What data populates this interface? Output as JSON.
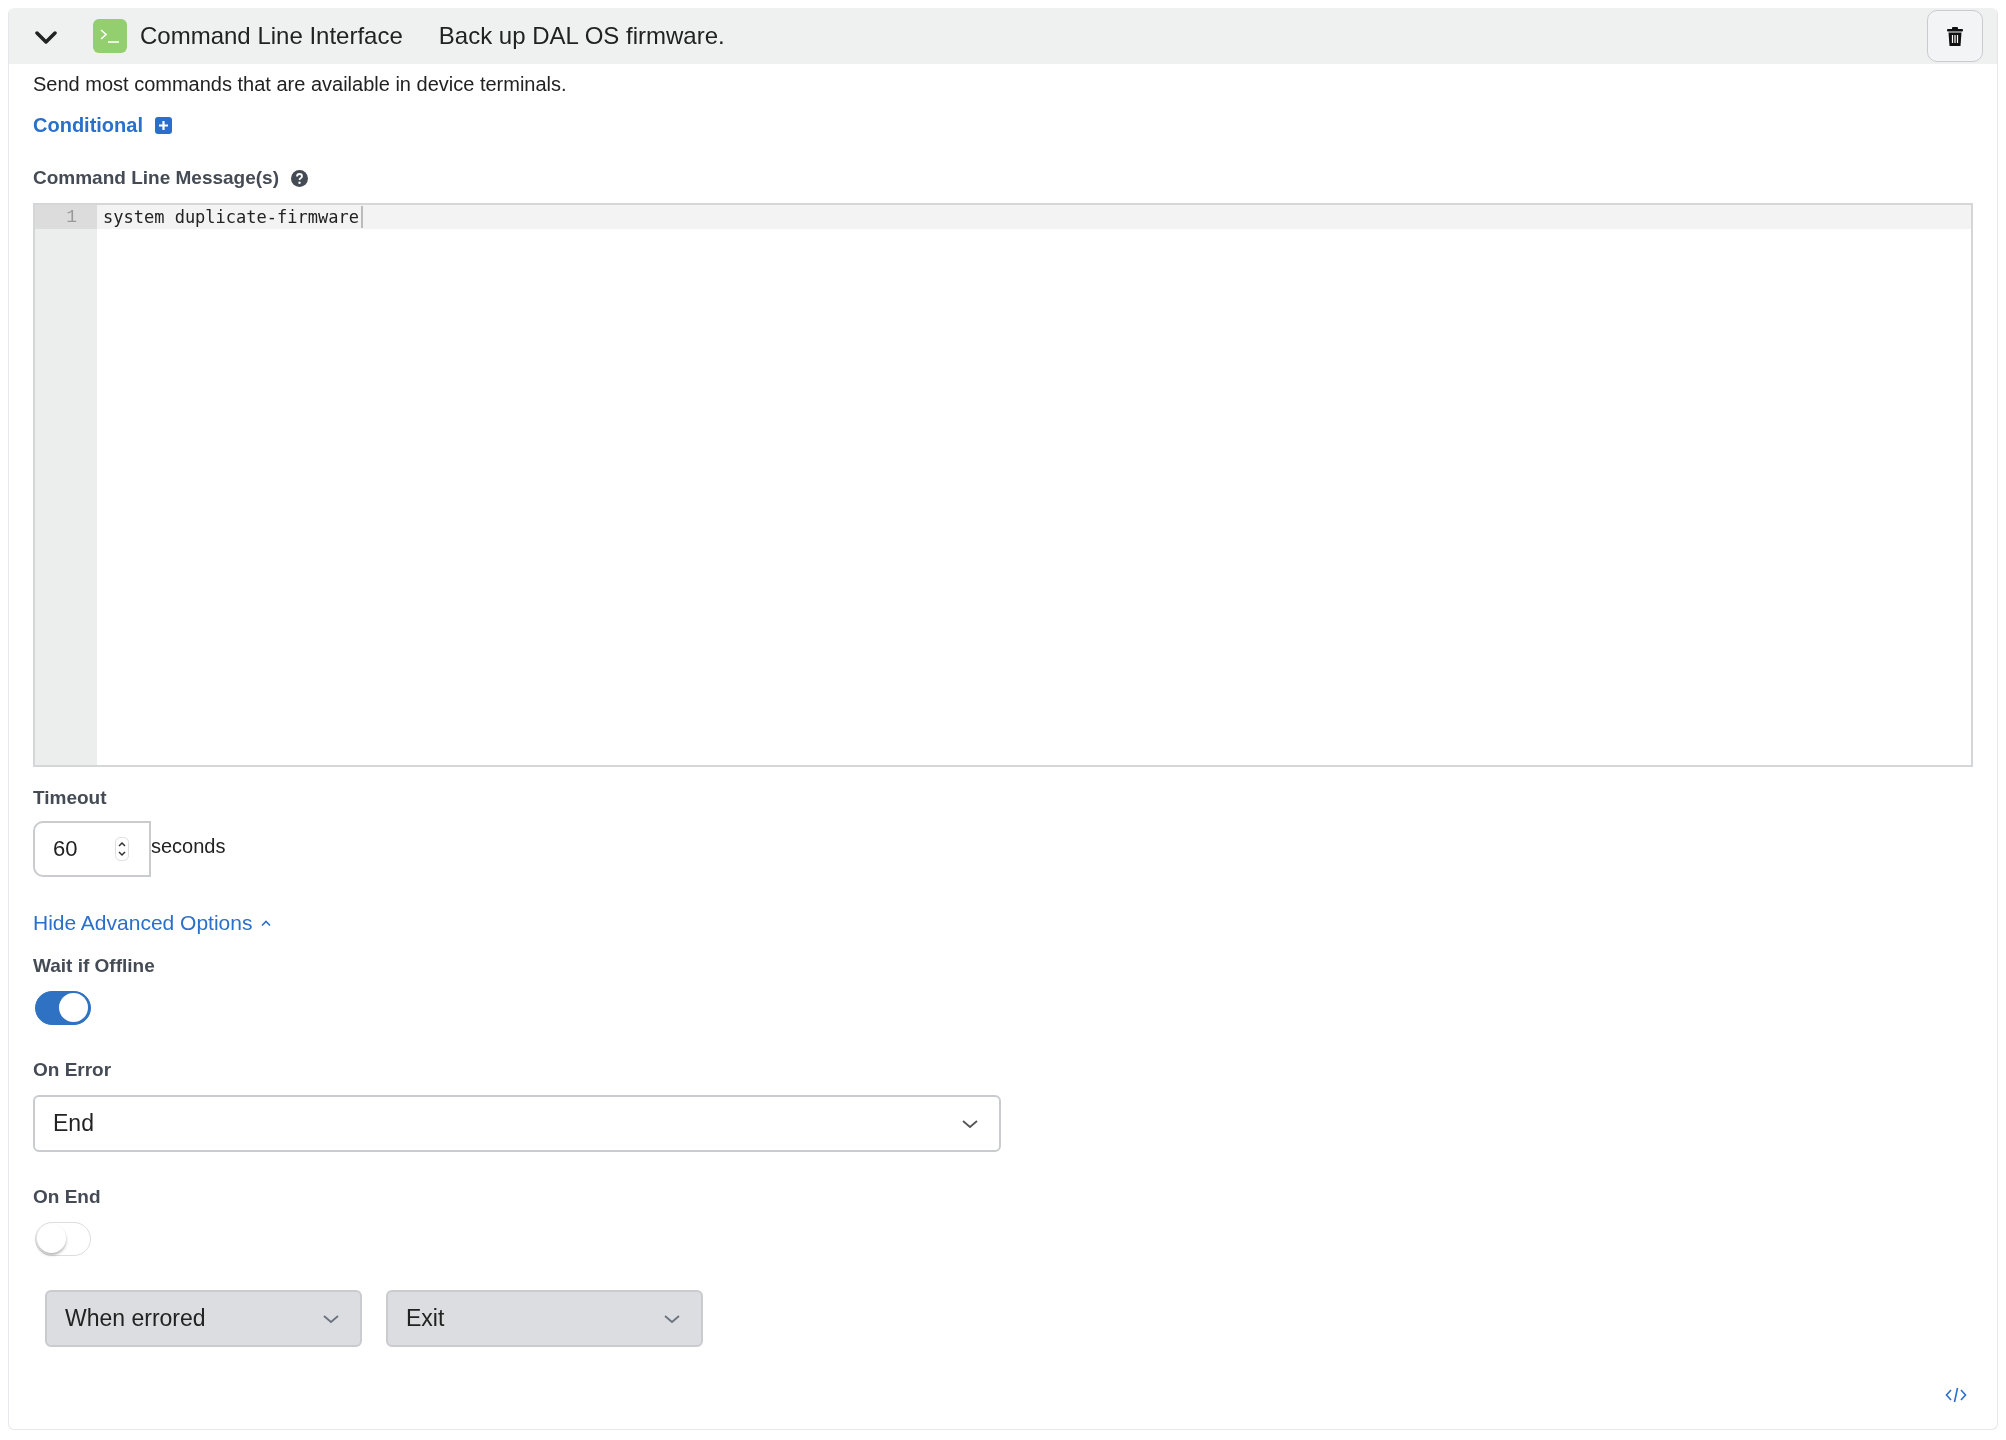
{
  "header": {
    "expanded": true,
    "title": "Command Line Interface",
    "name": "Back up DAL OS firmware."
  },
  "description": "Send most commands that are available in device terminals.",
  "conditional": {
    "label": "Conditional"
  },
  "messages": {
    "label": "Command Line Message(s)",
    "lines": [
      {
        "number": "1",
        "text": "system duplicate-firmware"
      }
    ]
  },
  "timeout": {
    "label": "Timeout",
    "value": "60",
    "unit": "seconds"
  },
  "advanced_toggle": {
    "label": "Hide Advanced Options",
    "expanded": true
  },
  "wait_if_offline": {
    "label": "Wait if Offline",
    "on": true
  },
  "on_error": {
    "label": "On Error",
    "value": "End"
  },
  "on_end": {
    "label": "On End",
    "on": false,
    "selects": [
      {
        "value": "When errored",
        "disabled": true
      },
      {
        "value": "Exit",
        "disabled": true
      }
    ]
  }
}
